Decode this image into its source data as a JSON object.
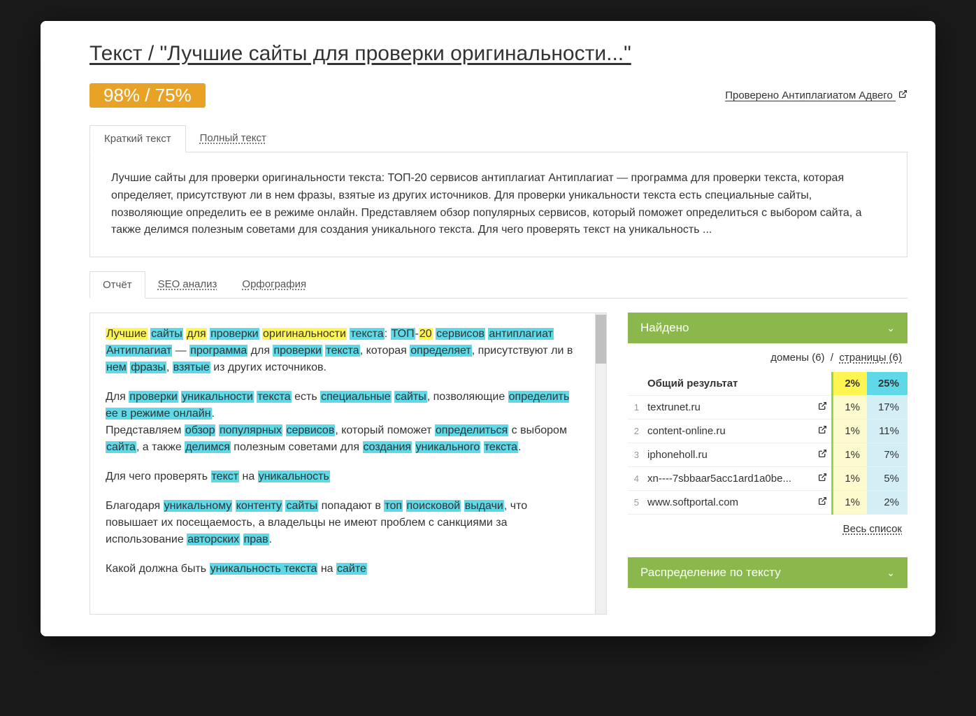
{
  "pageTitle": "Текст / \"Лучшие сайты для проверки оригинальности...\"",
  "scoreBadge": "98% / 75%",
  "checkedBy": "Проверено Антиплагиатом Адвего",
  "textTabs": {
    "short": "Краткий текст",
    "full": "Полный текст"
  },
  "shortText": "Лучшие сайты для проверки оригинальности текста: ТОП-20 сервисов антиплагиат Антиплагиат — программа для проверки текста, которая определяет, присутствуют ли в нем фразы, взятые из других источников. Для проверки уникальности текста есть специальные сайты, позволяющие определить ее в режиме онлайн. Представляем обзор популярных сервисов, который поможет определиться с выбором сайта, а также делимся полезным советами для создания уникального текста. Для чего проверять текст на уникальность ...",
  "reportTabs": {
    "report": "Отчёт",
    "seo": "SEO анализ",
    "spelling": "Орфография"
  },
  "foundPanel": {
    "title": "Найдено",
    "domainsLabel": "домены (6)",
    "pagesLabel": "страницы (6)"
  },
  "resultsHeader": {
    "label": "Общий результат",
    "pct1": "2%",
    "pct2": "25%"
  },
  "domains": [
    {
      "idx": "1",
      "name": "textrunet.ru",
      "pct1": "1%",
      "pct2": "17%"
    },
    {
      "idx": "2",
      "name": "content-online.ru",
      "pct1": "1%",
      "pct2": "11%"
    },
    {
      "idx": "3",
      "name": "iphoneholl.ru",
      "pct1": "1%",
      "pct2": "7%"
    },
    {
      "idx": "4",
      "name": "xn----7sbbaar5acc1ard1a0be...",
      "pct1": "1%",
      "pct2": "5%"
    },
    {
      "idx": "5",
      "name": "www.softportal.com",
      "pct1": "1%",
      "pct2": "2%"
    }
  ],
  "fullListLink": "Весь список",
  "distributionPanel": "Распределение по тексту"
}
